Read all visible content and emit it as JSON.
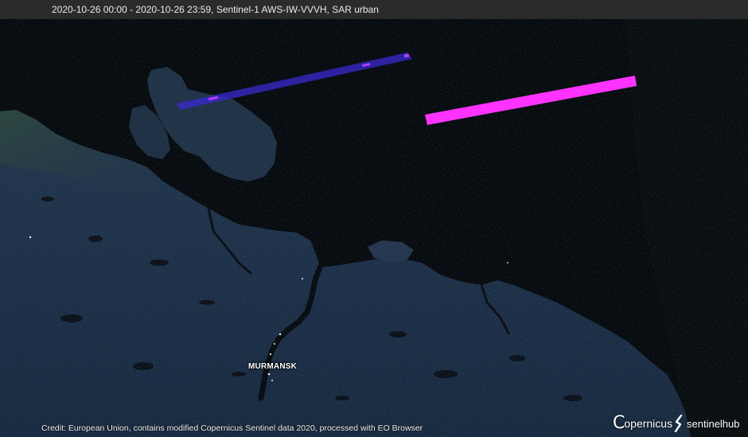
{
  "header": {
    "title": "2020-10-26 00:00 - 2020-10-26 23:59, Sentinel-1 AWS-IW-VVVH, SAR urban"
  },
  "map": {
    "city_label": "MURMANSK",
    "swath_color": "#ff33ff",
    "land_color": "#1c2f45",
    "sea_color": "#020405"
  },
  "footer": {
    "credit": "Credit: European Union, contains modified Copernicus Sentinel data 2020, processed with EO Browser",
    "logo_copernicus": "opernicus",
    "logo_sentinelhub": "sentinelhub"
  },
  "icons": {
    "copernicus": "copernicus-logo-icon",
    "sentinelhub": "sentinelhub-logo-icon"
  }
}
